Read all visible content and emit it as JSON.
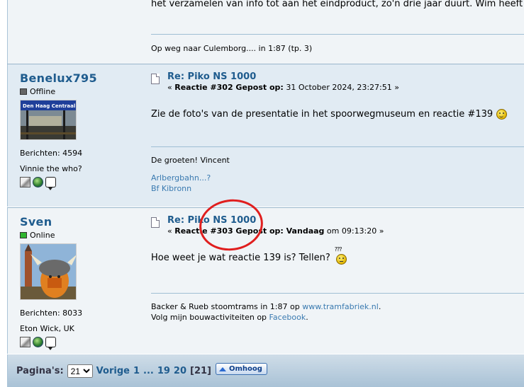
{
  "post0": {
    "body_text": "het verzamelen van info tot aan het eindproduct, zo'n drie jaar duurt. Wim heeft in",
    "signature": "Op weg naar Culemborg.... in 1:87 (tp. 3)"
  },
  "posts": [
    {
      "poster_name": "Benelux795",
      "status": "Offline",
      "avatar_text": "Den Haag Centraal",
      "post_count": "Berichten: 4594",
      "custom_title": "Vinnie the who?",
      "subject": "Re: Piko NS 1000",
      "meta_prefix": "« ",
      "meta_reply": "Reactie #302 Gepost op:",
      "meta_date": " 31 October 2024, 23:27:51 »",
      "body": "Zie de foto's van de presentatie in het spoorwegmuseum en reactie #139",
      "sig_line1": "De groeten! Vincent",
      "sig_link1": "Arlbergbahn...?",
      "sig_link2": "Bf Kibronn"
    },
    {
      "poster_name": "Sven",
      "status": "Online",
      "post_count": "Berichten: 8033",
      "custom_title": "Eton Wick, UK",
      "subject": "Re: Piko NS 1000",
      "meta_prefix": "« ",
      "meta_reply": "Reactie #303 Gepost op: Vandaag",
      "meta_date": " om 09:13:20 »",
      "body": "Hoe weet je wat reactie 139 is? Tellen?",
      "smiley_text": "???",
      "sig_text1": "Backer & Rueb stoomtrams in 1:87 op ",
      "sig_link1": "www.tramfabriek.nl",
      "sig_text1_end": ".",
      "sig_text2": "Volg mijn bouwactiviteiten op ",
      "sig_link2": "Facebook",
      "sig_text2_end": "."
    }
  ],
  "pagination": {
    "label": "Pagina's:",
    "selected_page": "21",
    "prev": "Vorige",
    "first": "1",
    "ellipsis": "...",
    "p19": "19",
    "p20": "20",
    "current": "[21]",
    "top_button": "Omhoog"
  },
  "colors": {
    "link": "#1f5c8e",
    "annotation": "#e01e1e"
  }
}
